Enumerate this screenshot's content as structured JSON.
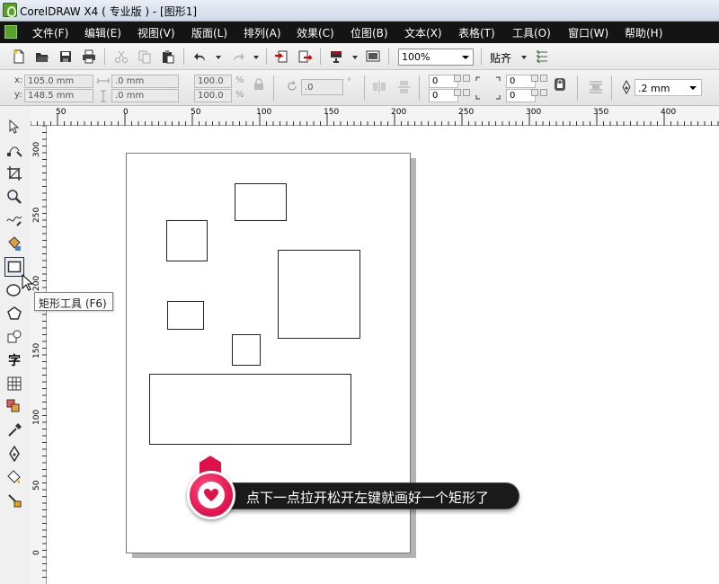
{
  "window": {
    "title": "CorelDRAW X4 ( 专业版 ) - [图形1]"
  },
  "menu": {
    "items": [
      "文件(F)",
      "编辑(E)",
      "视图(V)",
      "版面(L)",
      "排列(A)",
      "效果(C)",
      "位图(B)",
      "文本(X)",
      "表格(T)",
      "工具(O)",
      "窗口(W)",
      "帮助(H)"
    ]
  },
  "toolbar": {
    "zoom": "100%",
    "snap_label": "贴齐"
  },
  "propbar": {
    "x_label": "x:",
    "y_label": "y:",
    "x_value": "105.0 mm",
    "y_value": "148.5 mm",
    "width_value": ".0 mm",
    "height_value": ".0 mm",
    "scale_x": "100.0",
    "scale_y": "100.0",
    "percent": "%",
    "rotation": ".0",
    "degree": "°",
    "corner_tl": "0",
    "corner_bl": "0",
    "corner_tr": "0",
    "corner_br": "0",
    "outline_width": ".2 mm"
  },
  "ruler": {
    "h_labels": [
      "50",
      "0",
      "50",
      "100",
      "150",
      "200",
      "250",
      "300",
      "350",
      "400"
    ],
    "v_labels": [
      "300",
      "250",
      "200",
      "150",
      "100",
      "50",
      "0"
    ]
  },
  "tooltip": {
    "text": "矩形工具 (F6)"
  },
  "callout": {
    "text": "点下一点拉开松开左键就画好一个矩形了"
  },
  "colors": {
    "menubar_bg": "#141414",
    "callout_accent": "#e0104d",
    "callout_bar": "#1a1a1a"
  }
}
